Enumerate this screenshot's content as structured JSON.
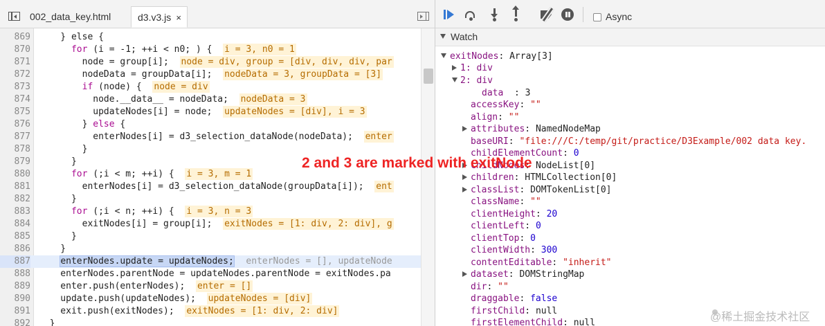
{
  "file_tabs": [
    {
      "label": "002_data_key.html",
      "active": false
    },
    {
      "label": "d3.v3.js",
      "active": true,
      "close": "×"
    }
  ],
  "code_lines": [
    {
      "n": "869",
      "segs": [
        [
          "t",
          "    } else {"
        ]
      ]
    },
    {
      "n": "870",
      "segs": [
        [
          "t",
          "      "
        ],
        [
          "kw",
          "for"
        ],
        [
          "t",
          " (i = -1; ++i < n0; ) {  "
        ],
        [
          "in",
          "i = 3, n0 = 1"
        ]
      ]
    },
    {
      "n": "871",
      "segs": [
        [
          "t",
          "        node = group[i];  "
        ],
        [
          "in",
          "node = div, group = [div, div, div, par"
        ]
      ]
    },
    {
      "n": "872",
      "segs": [
        [
          "t",
          "        nodeData = groupData[i];  "
        ],
        [
          "in",
          "nodeData = 3, groupData = [3]"
        ]
      ]
    },
    {
      "n": "873",
      "segs": [
        [
          "t",
          "        "
        ],
        [
          "kw",
          "if"
        ],
        [
          "t",
          " (node) {  "
        ],
        [
          "in",
          "node = div"
        ]
      ]
    },
    {
      "n": "874",
      "segs": [
        [
          "t",
          "          node.__data__ = nodeData;  "
        ],
        [
          "in",
          "nodeData = 3"
        ]
      ]
    },
    {
      "n": "875",
      "segs": [
        [
          "t",
          "          updateNodes[i] = node;  "
        ],
        [
          "in",
          "updateNodes = [div], i = 3"
        ]
      ]
    },
    {
      "n": "876",
      "segs": [
        [
          "t",
          "        } "
        ],
        [
          "kw",
          "else"
        ],
        [
          "t",
          " {"
        ]
      ]
    },
    {
      "n": "877",
      "segs": [
        [
          "t",
          "          enterNodes[i] = d3_selection_dataNode(nodeData);  "
        ],
        [
          "in",
          "enter"
        ]
      ]
    },
    {
      "n": "878",
      "segs": [
        [
          "t",
          "        }"
        ]
      ]
    },
    {
      "n": "879",
      "segs": [
        [
          "t",
          "      }"
        ]
      ]
    },
    {
      "n": "880",
      "segs": [
        [
          "t",
          "      "
        ],
        [
          "kw",
          "for"
        ],
        [
          "t",
          " (;i < m; ++i) {  "
        ],
        [
          "in",
          "i = 3, m = 1"
        ]
      ]
    },
    {
      "n": "881",
      "segs": [
        [
          "t",
          "        enterNodes[i] = d3_selection_dataNode(groupData[i]);  "
        ],
        [
          "in",
          "ent"
        ]
      ]
    },
    {
      "n": "882",
      "segs": [
        [
          "t",
          "      }"
        ]
      ]
    },
    {
      "n": "883",
      "segs": [
        [
          "t",
          "      "
        ],
        [
          "kw",
          "for"
        ],
        [
          "t",
          " (;i < n; ++i) {  "
        ],
        [
          "in",
          "i = 3, n = 3"
        ]
      ]
    },
    {
      "n": "884",
      "segs": [
        [
          "t",
          "        exitNodes[i] = group[i];  "
        ],
        [
          "in",
          "exitNodes = [1: div, 2: div], g"
        ]
      ]
    },
    {
      "n": "885",
      "segs": [
        [
          "t",
          "      }"
        ]
      ]
    },
    {
      "n": "886",
      "segs": [
        [
          "t",
          "    }"
        ]
      ]
    },
    {
      "n": "887",
      "hl": true,
      "segs": [
        [
          "t",
          "    "
        ],
        [
          "sel",
          "enterNodes.update = updateNodes;"
        ],
        [
          "t",
          "  "
        ],
        [
          "dim",
          "enterNodes = [], updateNode"
        ]
      ]
    },
    {
      "n": "888",
      "segs": [
        [
          "t",
          "    enterNodes.parentNode = updateNodes.parentNode = exitNodes.pa"
        ]
      ]
    },
    {
      "n": "889",
      "segs": [
        [
          "t",
          "    enter.push(enterNodes);  "
        ],
        [
          "in",
          "enter = []"
        ]
      ]
    },
    {
      "n": "890",
      "segs": [
        [
          "t",
          "    update.push(updateNodes);  "
        ],
        [
          "in",
          "updateNodes = [div]"
        ]
      ]
    },
    {
      "n": "891",
      "segs": [
        [
          "t",
          "    exit.push(exitNodes);  "
        ],
        [
          "in",
          "exitNodes = [1: div, 2: div]"
        ]
      ]
    },
    {
      "n": "892",
      "segs": [
        [
          "t",
          "  }"
        ]
      ]
    }
  ],
  "toolbar": {
    "icons": [
      "resume-icon",
      "step-over-icon",
      "step-into-icon",
      "step-out-icon",
      "deactivate-breakpoints-icon",
      "pause-on-exceptions-icon"
    ],
    "async_label": "Async"
  },
  "watch": {
    "title": "Watch",
    "root": {
      "name": "exitNodes",
      "value": "Array[3]"
    },
    "item1": {
      "name": "1",
      "value": "div"
    },
    "item2": {
      "name": "2",
      "value": "div"
    },
    "data_line": {
      "name": "data",
      "value": "3"
    },
    "props": [
      {
        "name": "accessKey",
        "value": "\"\"",
        "kind": "str",
        "expandable": false
      },
      {
        "name": "align",
        "value": "\"\"",
        "kind": "str",
        "expandable": false
      },
      {
        "name": "attributes",
        "value": "NamedNodeMap",
        "kind": "obj",
        "expandable": true
      },
      {
        "name": "baseURI",
        "value": "\"file:///C:/temp/git/practice/D3Example/002 data key.",
        "kind": "str",
        "expandable": false
      },
      {
        "name": "childElementCount",
        "value": "0",
        "kind": "num",
        "expandable": false
      },
      {
        "name": "childNodes",
        "value": "NodeList[0]",
        "kind": "obj",
        "expandable": true
      },
      {
        "name": "children",
        "value": "HTMLCollection[0]",
        "kind": "obj",
        "expandable": true
      },
      {
        "name": "classList",
        "value": "DOMTokenList[0]",
        "kind": "obj",
        "expandable": true
      },
      {
        "name": "className",
        "value": "\"\"",
        "kind": "str",
        "expandable": false
      },
      {
        "name": "clientHeight",
        "value": "20",
        "kind": "num",
        "expandable": false
      },
      {
        "name": "clientLeft",
        "value": "0",
        "kind": "num",
        "expandable": false
      },
      {
        "name": "clientTop",
        "value": "0",
        "kind": "num",
        "expandable": false
      },
      {
        "name": "clientWidth",
        "value": "300",
        "kind": "num",
        "expandable": false
      },
      {
        "name": "contentEditable",
        "value": "\"inherit\"",
        "kind": "str",
        "expandable": false
      },
      {
        "name": "dataset",
        "value": "DOMStringMap",
        "kind": "obj",
        "expandable": true
      },
      {
        "name": "dir",
        "value": "\"\"",
        "kind": "str",
        "expandable": false
      },
      {
        "name": "draggable",
        "value": "false",
        "kind": "num",
        "expandable": false
      },
      {
        "name": "firstChild",
        "value": "null",
        "kind": "obj",
        "expandable": false
      },
      {
        "name": "firstElementChild",
        "value": "null",
        "kind": "obj",
        "expandable": false
      }
    ]
  },
  "annotation": "2 and 3 are marked with exitNode",
  "watermark": "@稀土掘金技术社区"
}
